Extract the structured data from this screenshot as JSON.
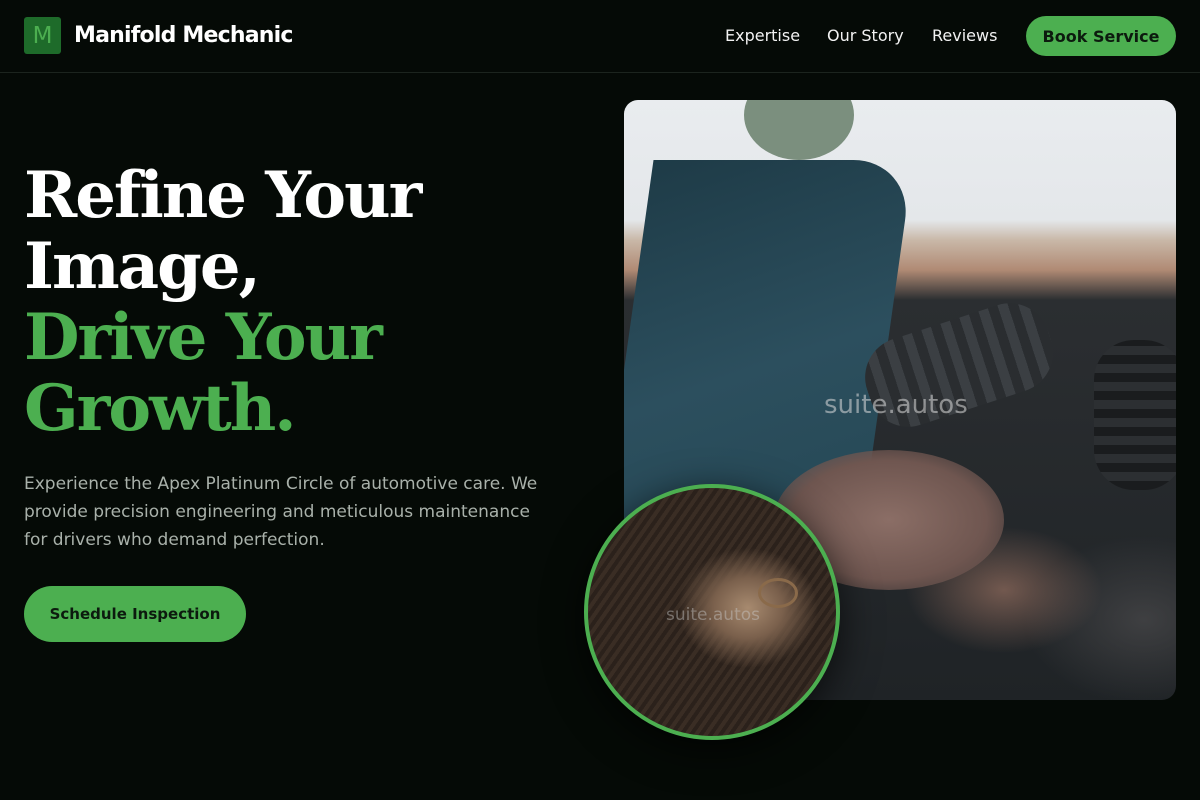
{
  "header": {
    "logo_letter": "M",
    "brand_name": "Manifold Mechanic",
    "nav": [
      {
        "label": "Expertise"
      },
      {
        "label": "Our Story"
      },
      {
        "label": "Reviews"
      }
    ],
    "book_label": "Book Service"
  },
  "hero": {
    "headline_line1": "Refine Your",
    "headline_line2": "Image,",
    "headline_line3": "Drive Your",
    "headline_line4": "Growth.",
    "description": "Experience the Apex Platinum Circle of automotive care. We provide precision engineering and meticulous maintenance for drivers who demand perfection.",
    "cta_label": "Schedule Inspection"
  },
  "images": {
    "main_watermark": "suite.autos",
    "circle_watermark": "suite.autos"
  },
  "colors": {
    "accent": "#4caf50",
    "background": "#050a06",
    "logo_bg": "#1e6b2a"
  }
}
